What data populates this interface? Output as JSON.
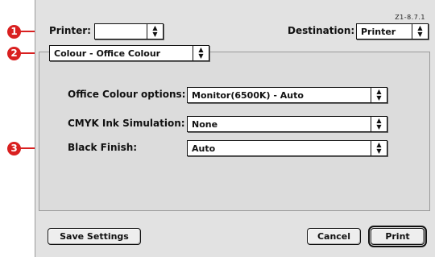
{
  "version": "Z1-8.7.1",
  "callouts": [
    "1",
    "2",
    "3"
  ],
  "printer": {
    "label": "Printer:",
    "value": ""
  },
  "destination": {
    "label": "Destination:",
    "value": "Printer"
  },
  "panel": {
    "value": "Colour - Office Colour"
  },
  "options": {
    "office_colour": {
      "label": "Office Colour options:",
      "value": "Monitor(6500K) - Auto"
    },
    "cmyk": {
      "label": "CMYK Ink Simulation:",
      "value": "None"
    },
    "black_finish": {
      "label": "Black Finish:",
      "value": "Auto"
    }
  },
  "buttons": {
    "save": "Save Settings",
    "cancel": "Cancel",
    "print": "Print"
  },
  "colors": {
    "callout": "#d92020",
    "dialog_bg": "#e2e2e2"
  },
  "icons": {
    "popup_arrows": "updown-arrows-icon"
  }
}
